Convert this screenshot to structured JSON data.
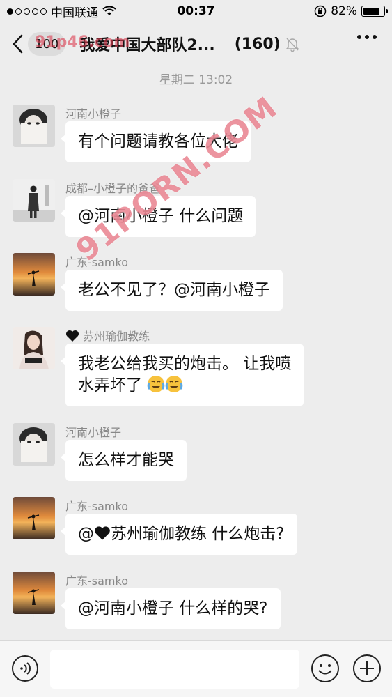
{
  "status_bar": {
    "carrier": "中国联通",
    "time": "00:37",
    "battery_percent": "82%",
    "battery_level": 0.82,
    "signal_bars_filled": 1,
    "signal_bars_total": 5
  },
  "nav": {
    "unread_count": "100",
    "title": "我爱中国大部队2...",
    "member_count": "(160)"
  },
  "watermark": {
    "main": "91PORN.COM",
    "small": "91p46.com"
  },
  "timestamp": "星期二 13:02",
  "messages": [
    {
      "sender": "河南小橙子",
      "text": "有个问题请教各位大佬"
    },
    {
      "sender": "成都–小橙子的爸爸",
      "text": "@河南小橙子 什么问题"
    },
    {
      "sender": "广东-samko",
      "text": "老公不见了？@河南小橙子"
    },
    {
      "sender": "苏州瑜伽教练",
      "sender_prefix_icon": "black-heart-icon",
      "text_line1": "我老公给我买的炮击。 让我喷",
      "text_line2": "水弄坏了"
    },
    {
      "sender": "河南小橙子",
      "text": "怎么样才能哭"
    },
    {
      "sender": "广东-samko",
      "text_prefix": "@",
      "text_suffix": "苏州瑜伽教练 什么炮击?"
    },
    {
      "sender": "广东-samko",
      "text": "@河南小橙子 什么样的哭?"
    }
  ],
  "input": {
    "placeholder": ""
  },
  "colors": {
    "background": "#ededed",
    "bubble": "#ffffff",
    "watermark": "#dc3c50"
  }
}
